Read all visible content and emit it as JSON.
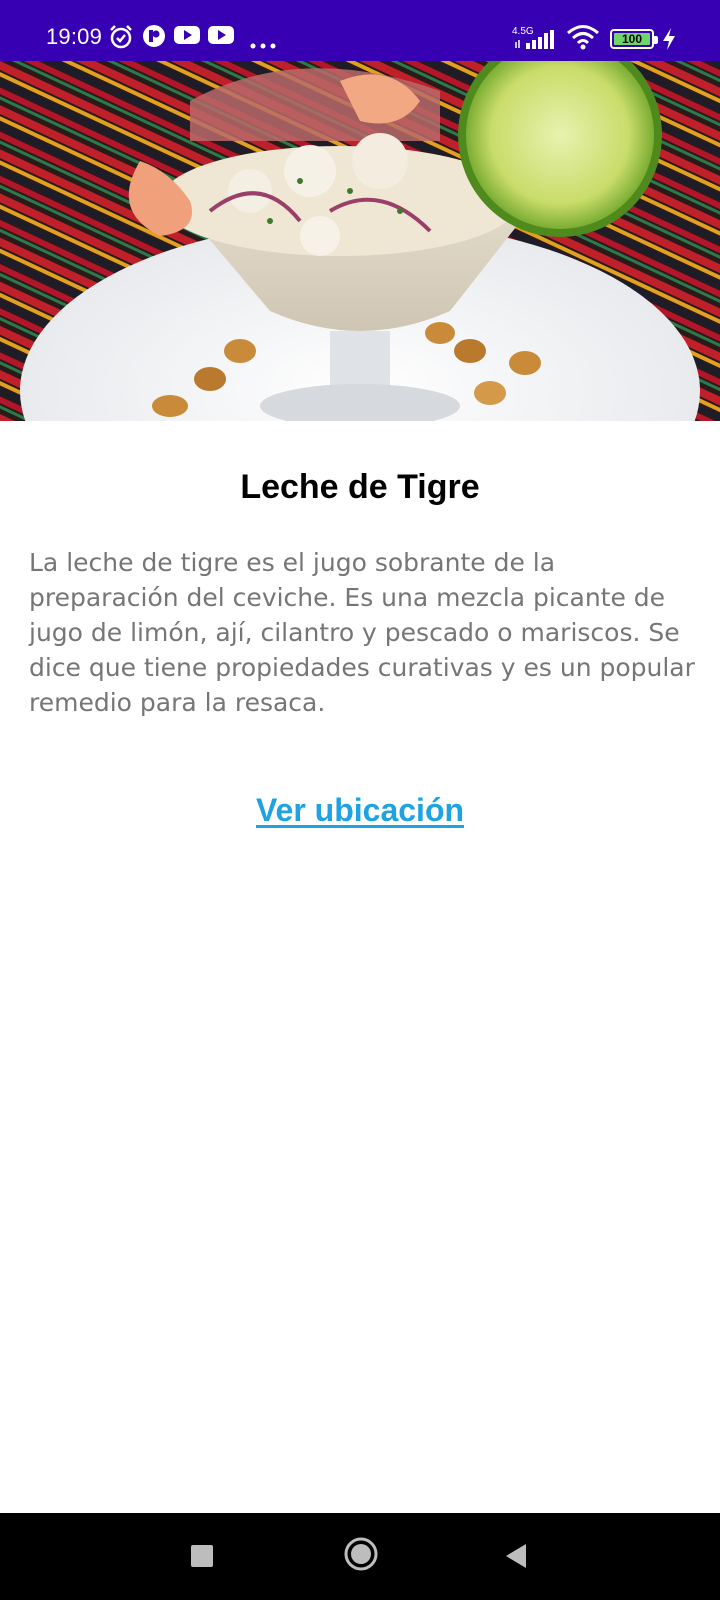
{
  "status_bar": {
    "time": "19:09",
    "network": "4.5G",
    "battery": "100",
    "icons": [
      "alarm-icon",
      "app-notification-icon",
      "youtube-icon",
      "youtube-icon",
      "more-notifications-icon",
      "signal-icon",
      "wifi-icon",
      "battery-icon",
      "charging-icon"
    ]
  },
  "hero_image": {
    "subject": "leche-de-tigre-photo"
  },
  "content": {
    "title": "Leche de Tigre",
    "description": "La leche de tigre es el jugo sobrante de la preparación del ceviche. Es una mezcla picante de jugo de limón, ají, cilantro y pescado o mariscos. Se dice que tiene propiedades curativas y es un popular remedio para la resaca.",
    "link_label": "Ver ubicación"
  },
  "colors": {
    "status_bar": "#3700b3",
    "title": "#000000",
    "description": "#767676",
    "link": "#1ea2e3",
    "nav_bar": "#000000"
  },
  "nav_bar": {
    "buttons": [
      "recents-button",
      "home-button",
      "back-button"
    ]
  }
}
